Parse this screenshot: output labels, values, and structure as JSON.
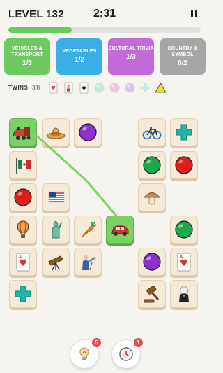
{
  "header": {
    "level": "LEVEL 132",
    "timer": "2:31"
  },
  "progress": {
    "fraction": 0.33
  },
  "categories": [
    {
      "name": "VEHICLES & TRANSPORT",
      "count": "1/3",
      "color": "#6dca5e"
    },
    {
      "name": "VEGETABLES",
      "count": "1/2",
      "color": "#3aaee8"
    },
    {
      "name": "CULTURAL TRIVIA",
      "count": "1/3",
      "color": "#c36ad9"
    },
    {
      "name": "COUNTRY & SYMBOL",
      "count": "0/2",
      "color": "#a6a6a6"
    }
  ],
  "twins": {
    "label": "TWINS",
    "count": "3/8",
    "items": [
      "ace-of-hearts-card",
      "king-card",
      "ace-of-spades-card",
      "green-ball",
      "pink-ball",
      "lavender-ball",
      "teal-cross",
      "yellow-triangle"
    ]
  },
  "tiles": [
    {
      "icon": "train-icon",
      "selected": true
    },
    {
      "icon": "sombrero-icon"
    },
    {
      "icon": "purple-ball-icon"
    },
    {
      "icon": "bicycle-icon"
    },
    {
      "icon": "cross-icon"
    },
    {
      "icon": "mexico-flag-icon"
    },
    {
      "icon": "green-ball-icon"
    },
    {
      "icon": "red-ball-icon"
    },
    {
      "icon": "red-ball-icon"
    },
    {
      "icon": "usa-flag-icon"
    },
    {
      "icon": "mushroom-icon"
    },
    {
      "icon": "hot-air-balloon-icon"
    },
    {
      "icon": "statue-of-liberty-icon"
    },
    {
      "icon": "carrot-icon"
    },
    {
      "icon": "car-icon",
      "selected": true
    },
    {
      "icon": "green-ball-icon"
    },
    {
      "icon": "ace-of-hearts-icon"
    },
    {
      "icon": "telescope-icon"
    },
    {
      "icon": "astronomer-icon"
    },
    {
      "icon": "purple-ball-icon"
    },
    {
      "icon": "ace-of-hearts-icon"
    },
    {
      "icon": "cross-icon"
    },
    {
      "icon": "gavel-icon"
    },
    {
      "icon": "judge-icon"
    }
  ],
  "boosters": [
    {
      "name": "hint-lightbulb",
      "count": "5"
    },
    {
      "name": "freeze-clock",
      "count": "1"
    }
  ],
  "colors": {
    "accent": "#6dca5e",
    "tile": "#f5e9d8",
    "badge": "#e84b4b"
  }
}
